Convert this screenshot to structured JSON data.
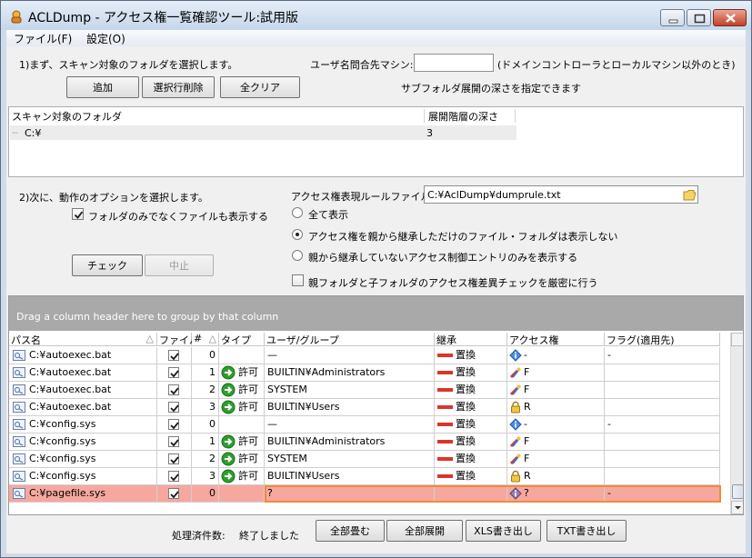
{
  "window": {
    "title": "ACLDump - アクセス権一覧確認ツール:試用版"
  },
  "menu": {
    "file": "ファイル(F)",
    "settings": "設定(O)"
  },
  "step1": {
    "instruction": "1)まず、スキャン対象のフォルダを選択します。",
    "add_button": "追加",
    "delete_row_button": "選択行削除",
    "clear_all_button": "全クリア",
    "user_machine_label": "ユーザ名問合先マシン:",
    "user_machine_value": "",
    "user_machine_note": "(ドメインコントローラとローカルマシン以外のとき)",
    "subfolder_note": "サブフォルダ展開の深さを指定できます"
  },
  "folder_list": {
    "columns": [
      "スキャン対象のフォルダ",
      "展開階層の深さ"
    ],
    "rows": [
      {
        "folder": "C:¥",
        "depth": "3"
      }
    ]
  },
  "step2": {
    "instruction": "2)次に、動作のオプションを選択します。",
    "show_files_label": "フォルダのみでなくファイルも表示する",
    "show_files_checked": true,
    "check_button": "チェック",
    "stop_button": "中止",
    "rule_file_label": "アクセス権表現ルールファイル:",
    "rule_file_value": "C:¥AclDump¥dumprule.txt",
    "options": [
      {
        "label": "全て表示",
        "selected": false
      },
      {
        "label": "アクセス権を親から継承しただけのファイル・フォルダは表示しない",
        "selected": true
      },
      {
        "label": "親から継承していないアクセス制御エントリのみを表示する",
        "selected": false
      }
    ],
    "strict_check_label": "親フォルダと子フォルダのアクセス権差異チェックを厳密に行う",
    "strict_check_checked": false
  },
  "grid": {
    "group_hint": "Drag a column header here to group by that column",
    "columns": [
      "パス名",
      "ファイル",
      "#",
      "タイプ",
      "ユーザ/グループ",
      "継承",
      "アクセス権",
      "フラグ(適用先)"
    ],
    "rows": [
      {
        "path": "C:¥autoexec.bat",
        "file": true,
        "num": "0",
        "type": "",
        "user": "—",
        "inherit": "置換",
        "access": "-",
        "access_icon": "info-icon",
        "flag": "-"
      },
      {
        "path": "C:¥autoexec.bat",
        "file": true,
        "num": "1",
        "type": "許可",
        "user": "BUILTIN¥Administrators",
        "inherit": "置換",
        "access": "F",
        "access_icon": "tools-icon",
        "flag": ""
      },
      {
        "path": "C:¥autoexec.bat",
        "file": true,
        "num": "2",
        "type": "許可",
        "user": "SYSTEM",
        "inherit": "置換",
        "access": "F",
        "access_icon": "tools-icon",
        "flag": ""
      },
      {
        "path": "C:¥autoexec.bat",
        "file": true,
        "num": "3",
        "type": "許可",
        "user": "BUILTIN¥Users",
        "inherit": "置換",
        "access": "R",
        "access_icon": "lock-icon",
        "flag": ""
      },
      {
        "path": "C:¥config.sys",
        "file": true,
        "num": "0",
        "type": "",
        "user": "—",
        "inherit": "置換",
        "access": "-",
        "access_icon": "info-icon",
        "flag": "-"
      },
      {
        "path": "C:¥config.sys",
        "file": true,
        "num": "1",
        "type": "許可",
        "user": "BUILTIN¥Administrators",
        "inherit": "置換",
        "access": "F",
        "access_icon": "tools-icon",
        "flag": ""
      },
      {
        "path": "C:¥config.sys",
        "file": true,
        "num": "2",
        "type": "許可",
        "user": "SYSTEM",
        "inherit": "置換",
        "access": "F",
        "access_icon": "tools-icon",
        "flag": ""
      },
      {
        "path": "C:¥config.sys",
        "file": true,
        "num": "3",
        "type": "許可",
        "user": "BUILTIN¥Users",
        "inherit": "置換",
        "access": "R",
        "access_icon": "lock-icon",
        "flag": ""
      },
      {
        "path": "C:¥pagefile.sys",
        "file": true,
        "num": "0",
        "type": "",
        "user": "?",
        "inherit": "",
        "access": "?",
        "access_icon": "unknown-icon",
        "flag": "-",
        "error": true
      }
    ]
  },
  "footer": {
    "status_label": "処理済件数:",
    "status_value": "終了しました",
    "collapse_all": "全部畳む",
    "expand_all": "全部展開",
    "export_xls": "XLS書き出し",
    "export_txt": "TXT書き出し"
  },
  "colors": {
    "error_row": "#f6a89f",
    "error_outline": "#f08a3c",
    "inherit_bar": "#d9362b",
    "allow_icon": "#2e9e2e"
  }
}
